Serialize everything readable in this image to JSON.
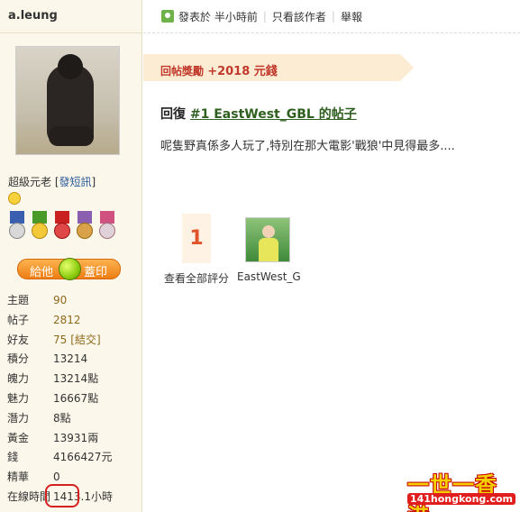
{
  "sidebar": {
    "username": "a.leung",
    "rank": "超級元老",
    "pm_link": "發短訊",
    "give_button": {
      "left": "給他",
      "right": "蓋印"
    },
    "stats": [
      {
        "key": "主題",
        "value": "90",
        "link": true
      },
      {
        "key": "帖子",
        "value": "2812",
        "link": true
      },
      {
        "key": "好友",
        "value": "75",
        "link": true,
        "extra": "[結交]"
      },
      {
        "key": "積分",
        "value": "13214"
      },
      {
        "key": "魄力",
        "value": "13214",
        "unit": "點"
      },
      {
        "key": "魅力",
        "value": "16667",
        "unit": "點"
      },
      {
        "key": "潛力",
        "value": "8",
        "unit": "點"
      },
      {
        "key": "黃金",
        "value": "13931",
        "unit": "兩"
      },
      {
        "key": "錢",
        "value": "4166427",
        "unit": "元"
      },
      {
        "key": "精華",
        "value": "0"
      },
      {
        "key": "在線時間",
        "value": "1413.1",
        "unit": "小時"
      }
    ],
    "medals": [
      {
        "ribbon": "#3a5fb0",
        "coin": "#d8d8d8"
      },
      {
        "ribbon": "#4a9a2a",
        "coin": "#f3c93a"
      },
      {
        "ribbon": "#c92020",
        "coin": "#e04848"
      },
      {
        "ribbon": "#8a5fb0",
        "coin": "#d9a24a"
      },
      {
        "ribbon": "#d05080",
        "coin": "#e0d0d8"
      }
    ]
  },
  "post": {
    "posted": "發表於 半小時前",
    "only_author": "只看該作者",
    "report": "舉報",
    "reward_label": "回帖獎勵",
    "reward_amount": "+2018 元錢",
    "reply_prefix": "回復",
    "reply_link": "EastWest_GBL 的帖子",
    "reply_number": "#1",
    "body": "呢隻野真係多人玩了,特別在那大電影'戰狼'中見得最多....",
    "rating_count": "1",
    "rating_label": "查看全部評分",
    "rater_name": "EastWest_G"
  },
  "watermark": {
    "top": "一世一香港",
    "bottom": "141hongkong.com"
  }
}
